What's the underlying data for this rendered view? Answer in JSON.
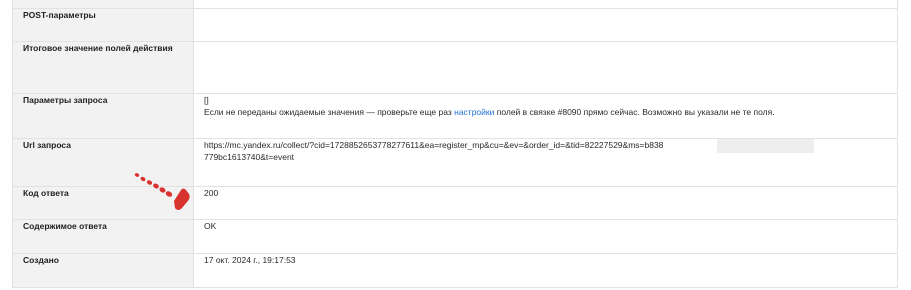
{
  "rows": [
    {
      "label": "POST-параметры",
      "value": ""
    },
    {
      "label": "Итоговое значение полей действия",
      "value": ""
    },
    {
      "label": "Параметры запроса",
      "value_line1": "[]",
      "value_line2_before": "Если не переданы ожидаемые значения — проверьте еще раз ",
      "value_line2_link": "настройки",
      "value_line2_after": " полей в связке #8090 прямо сейчас. Возможно вы указали не те поля."
    },
    {
      "label": "Url запроса",
      "value": "https://mc.yandex.ru/collect/?cid=172885265377827​7611&ea=register_mp&cu=&ev=&order_id=&tid=82227529&ms=b838",
      "value_cont": "779bc1613740&t=event"
    },
    {
      "label": "Код ответа",
      "value": "200"
    },
    {
      "label": "Содержимое ответа",
      "value": "OK"
    },
    {
      "label": "Создано",
      "value": "17 окт. 2024 г., 19:17:53"
    }
  ],
  "colors": {
    "label_bg": "#f2f2f2",
    "border": "#e2e2e2",
    "link": "#1f6fd1",
    "annotation_arrow": "#d9332f"
  }
}
